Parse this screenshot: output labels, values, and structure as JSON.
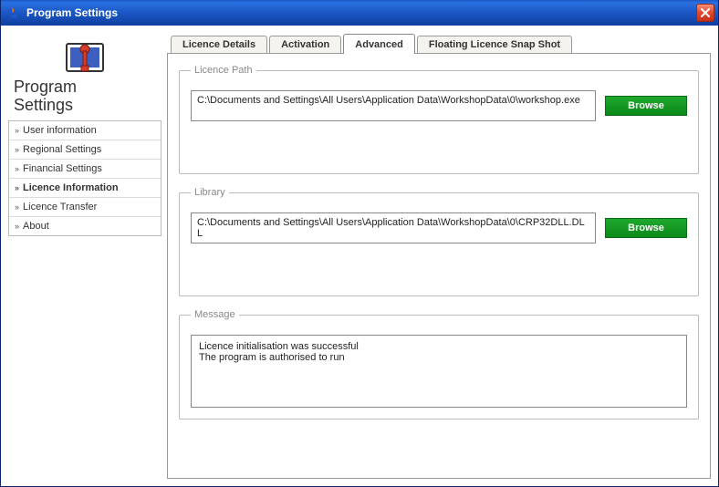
{
  "window": {
    "title": "Program Settings"
  },
  "sidebar": {
    "heading_line1": "Program",
    "heading_line2": "Settings",
    "items": [
      {
        "label": "User information"
      },
      {
        "label": "Regional Settings"
      },
      {
        "label": "Financial Settings"
      },
      {
        "label": "Licence Information",
        "active": true
      },
      {
        "label": "Licence Transfer"
      },
      {
        "label": "About"
      }
    ]
  },
  "tabs": [
    {
      "label": "Licence Details"
    },
    {
      "label": "Activation"
    },
    {
      "label": "Advanced",
      "active": true
    },
    {
      "label": "Floating Licence Snap Shot"
    }
  ],
  "panel": {
    "licence_path": {
      "legend": "Licence Path",
      "value": "C:\\Documents and Settings\\All Users\\Application Data\\WorkshopData\\0\\workshop.exe",
      "browse": "Browse"
    },
    "library": {
      "legend": "Library",
      "value": "C:\\Documents and Settings\\All Users\\Application Data\\WorkshopData\\0\\CRP32DLL.DLL",
      "browse": "Browse"
    },
    "message": {
      "legend": "Message",
      "value": "Licence initialisation was successful\nThe program is authorised to run"
    }
  }
}
